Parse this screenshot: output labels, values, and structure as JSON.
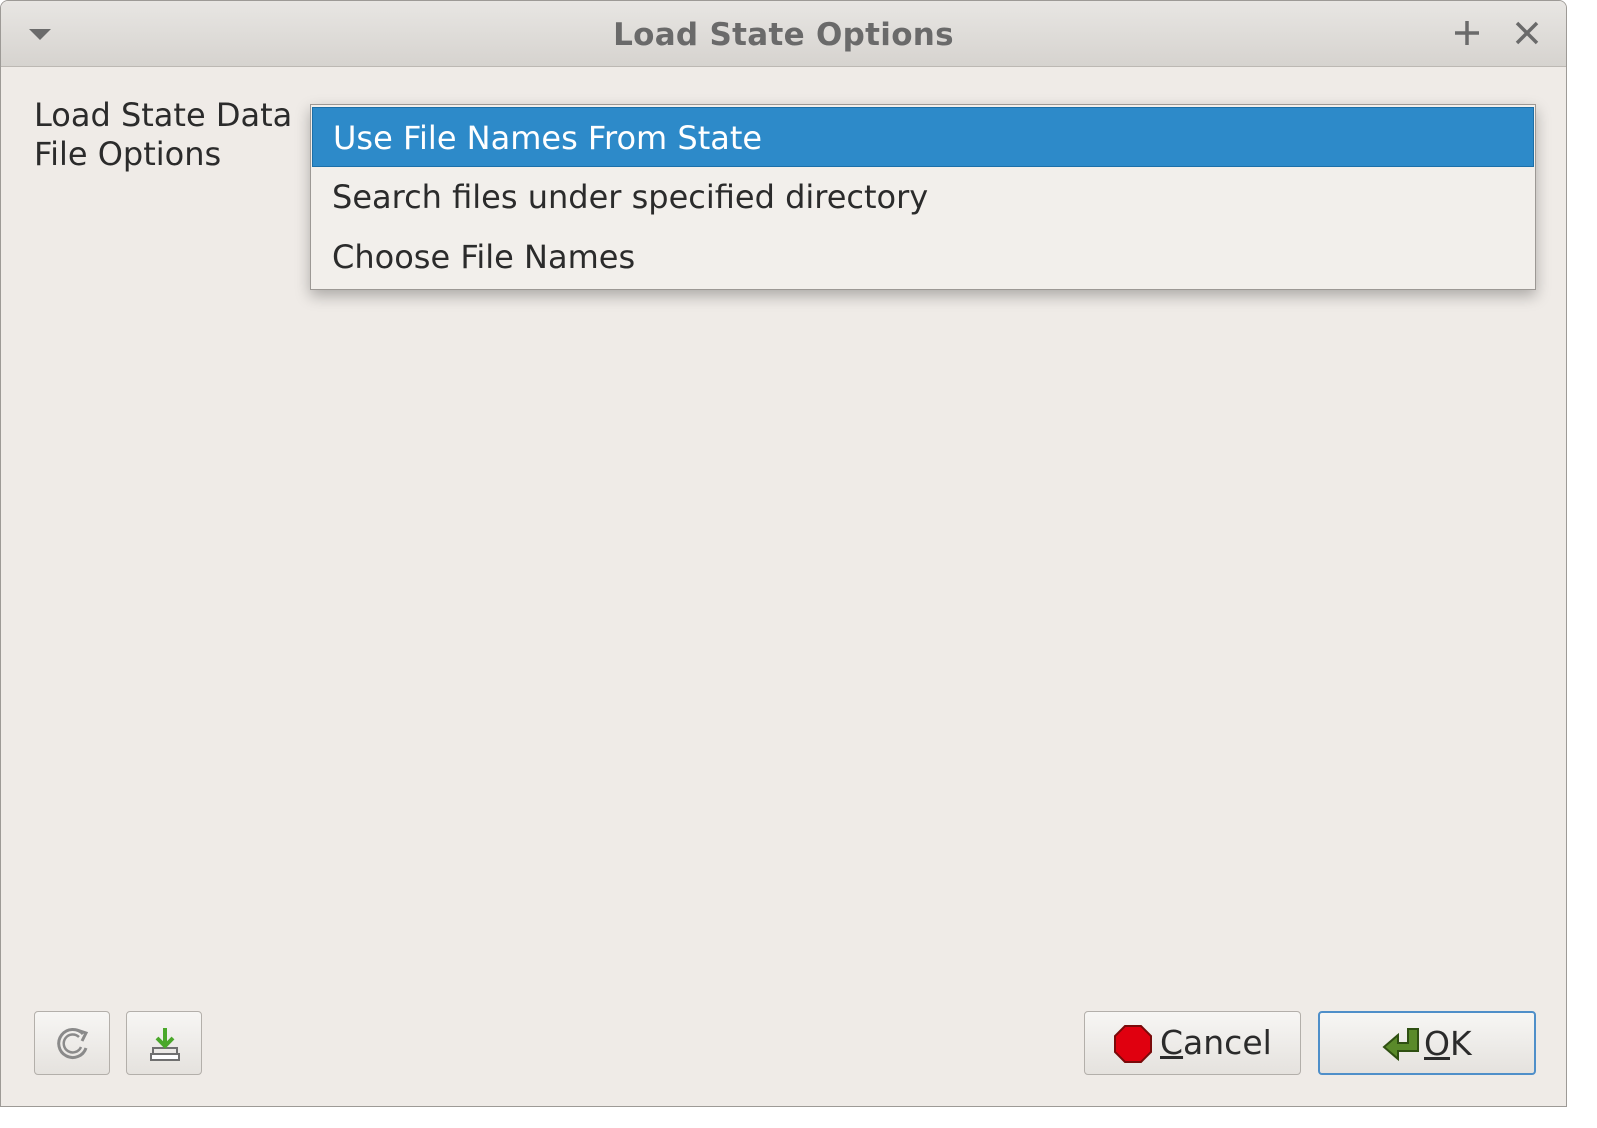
{
  "window": {
    "title": "Load State Options",
    "menu_icon": "window-menu-icon",
    "maximize_icon": "plus-icon",
    "close_icon": "close-icon"
  },
  "form": {
    "label_line1": "Load State Data",
    "label_line2": "File Options",
    "dropdown_options": [
      {
        "label": "Use File Names From State",
        "selected": true
      },
      {
        "label": "Search files under specified directory",
        "selected": false
      },
      {
        "label": "Choose File Names",
        "selected": false
      }
    ]
  },
  "footer": {
    "reset_icon": "reset-icon",
    "save_defaults_icon": "save-defaults-icon",
    "cancel_mnemonic": "C",
    "cancel_rest": "ancel",
    "ok_mnemonic": "O",
    "ok_rest": "K"
  },
  "colors": {
    "selection": "#2d8ac9",
    "window_bg": "#efebe7",
    "cancel_icon": "#e0000f",
    "ok_icon": "#5a8a2a"
  }
}
